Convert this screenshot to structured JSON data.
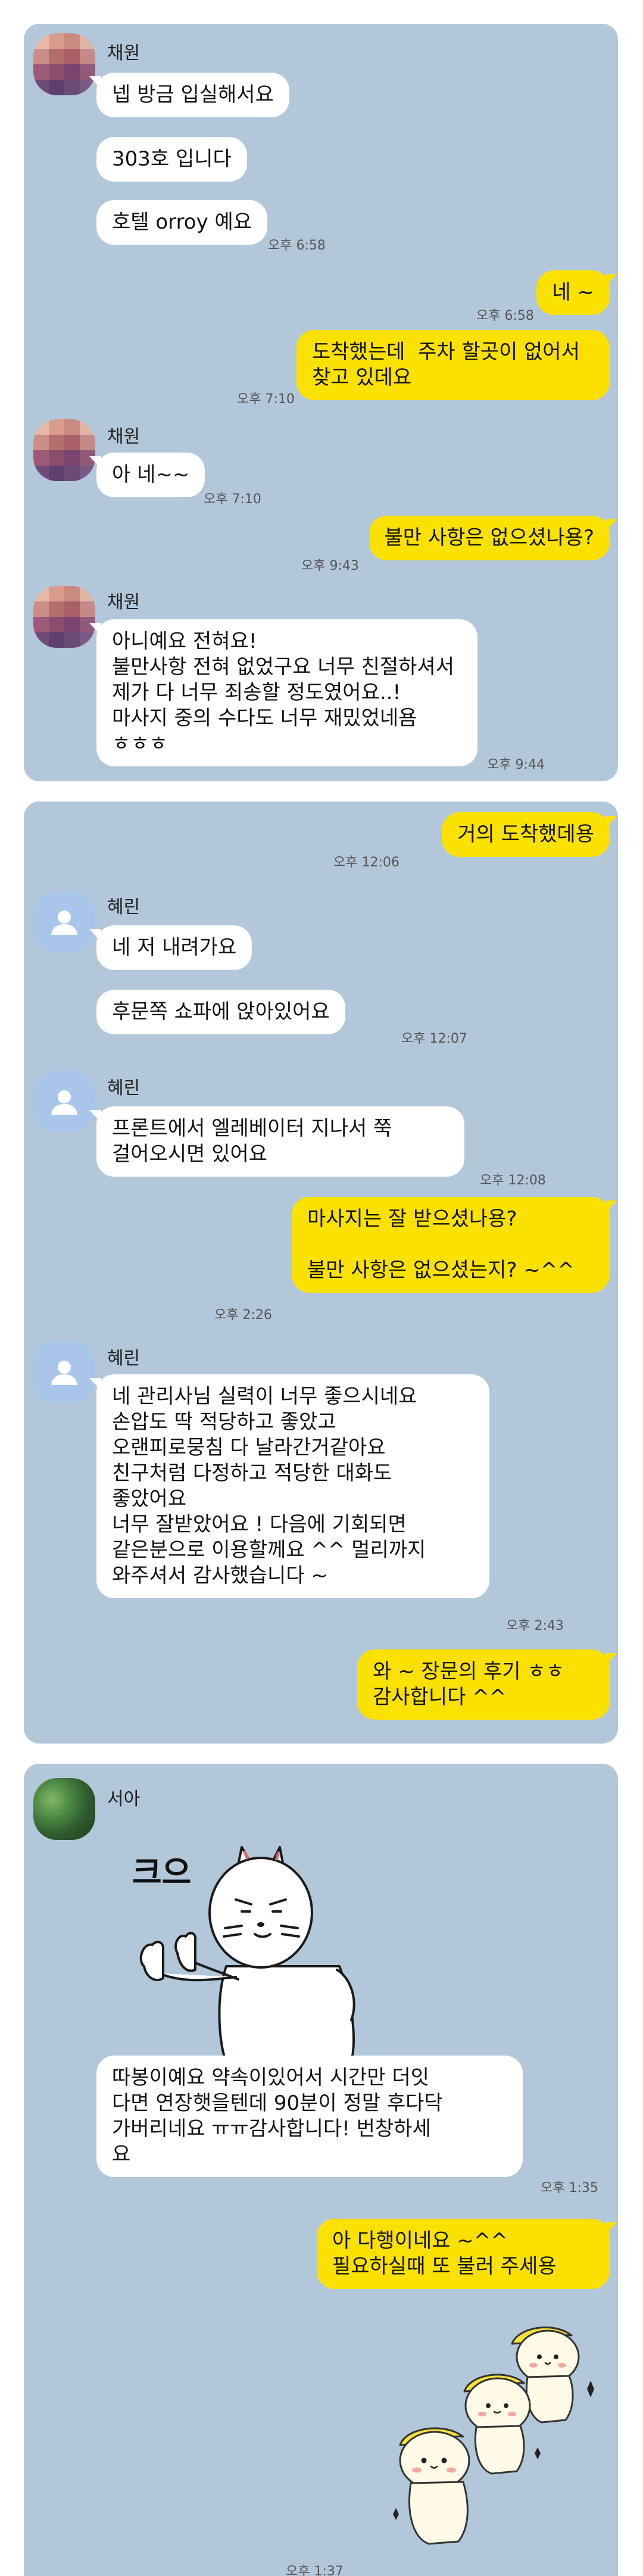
{
  "panel1": {
    "sender": "채원",
    "msg1": "넵 방금 입실해서요",
    "msg2": "303호 입니다",
    "msg3": "호텔 orroy 예요",
    "time1": "오후 6:58",
    "reply1": "네 ~",
    "reply1_time": "오후 6:58",
    "reply2": "도착했는데  주차 할곳이 없어서\n찾고 있데요",
    "reply2_time": "오후 7:10",
    "sender2": "채원",
    "msg4": "아 네~~",
    "msg4_time": "오후 7:10",
    "reply3": "불만 사항은 없으셨나용?",
    "reply3_time": "오후 9:43",
    "sender3": "채원",
    "msg5": "아니예요 전혀요!\n불만사항 전혀 없었구요 너무 친절하셔서\n제가 다 너무 죄송할 정도였어요..!\n마사지 중의 수다도 너무 재밌었네욤\nㅎㅎㅎ",
    "msg5_time": "오후 9:44"
  },
  "panel2": {
    "reply1": "거의 도착했데용",
    "reply1_time": "오후 12:06",
    "sender": "혜린",
    "msg1": "네 저 내려가요",
    "msg2": "후문쪽 쇼파에 앉아있어요",
    "msg2_time": "오후 12:07",
    "sender2": "혜린",
    "msg3": "프론트에서 엘레베이터 지나서 쭉\n걸어오시면 있어요",
    "msg3_time": "오후 12:08",
    "reply2": "마사지는 잘 받으셨나용?\n\n불만 사항은 없으셨는지? ~^^",
    "reply2_time": "오후 2:26",
    "sender3": "혜린",
    "msg4": "네 관리사님 실력이 너무 좋으시네요\n손압도 딱 적당하고 좋았고\n오랜피로뭉침 다 날라간거같아요\n친구처럼 다정하고 적당한 대화도\n좋았어요\n너무 잘받았어요 ! 다음에 기회되면\n같은분으로 이용할께요 ^^ 멀리까지\n와주셔서 감사했습니다 ~",
    "msg4_time": "오후 2:43",
    "reply3": "와 ~ 장문의 후기 ㅎㅎ\n감사합니다 ^^",
    "reply3_time": ""
  },
  "panel3": {
    "sender": "서아",
    "sticker_text": "크으",
    "msg1": "따봉이예요 약속이있어서 시간만 더잇\n다면 연장햇을텐데 90분이 정말 후다닥\n가버리네요 ㅠㅠ감사합니다! 번창하세\n요",
    "msg1_time": "오후 1:35",
    "reply1": "아 다행이네요 ~^^\n필요하실때 또 불러 주세용",
    "reply1_time": "오후 1:37"
  },
  "colors": {
    "chat_bg": "#b2c7da",
    "outgoing_bubble": "#fae100",
    "incoming_bubble": "#ffffff"
  }
}
